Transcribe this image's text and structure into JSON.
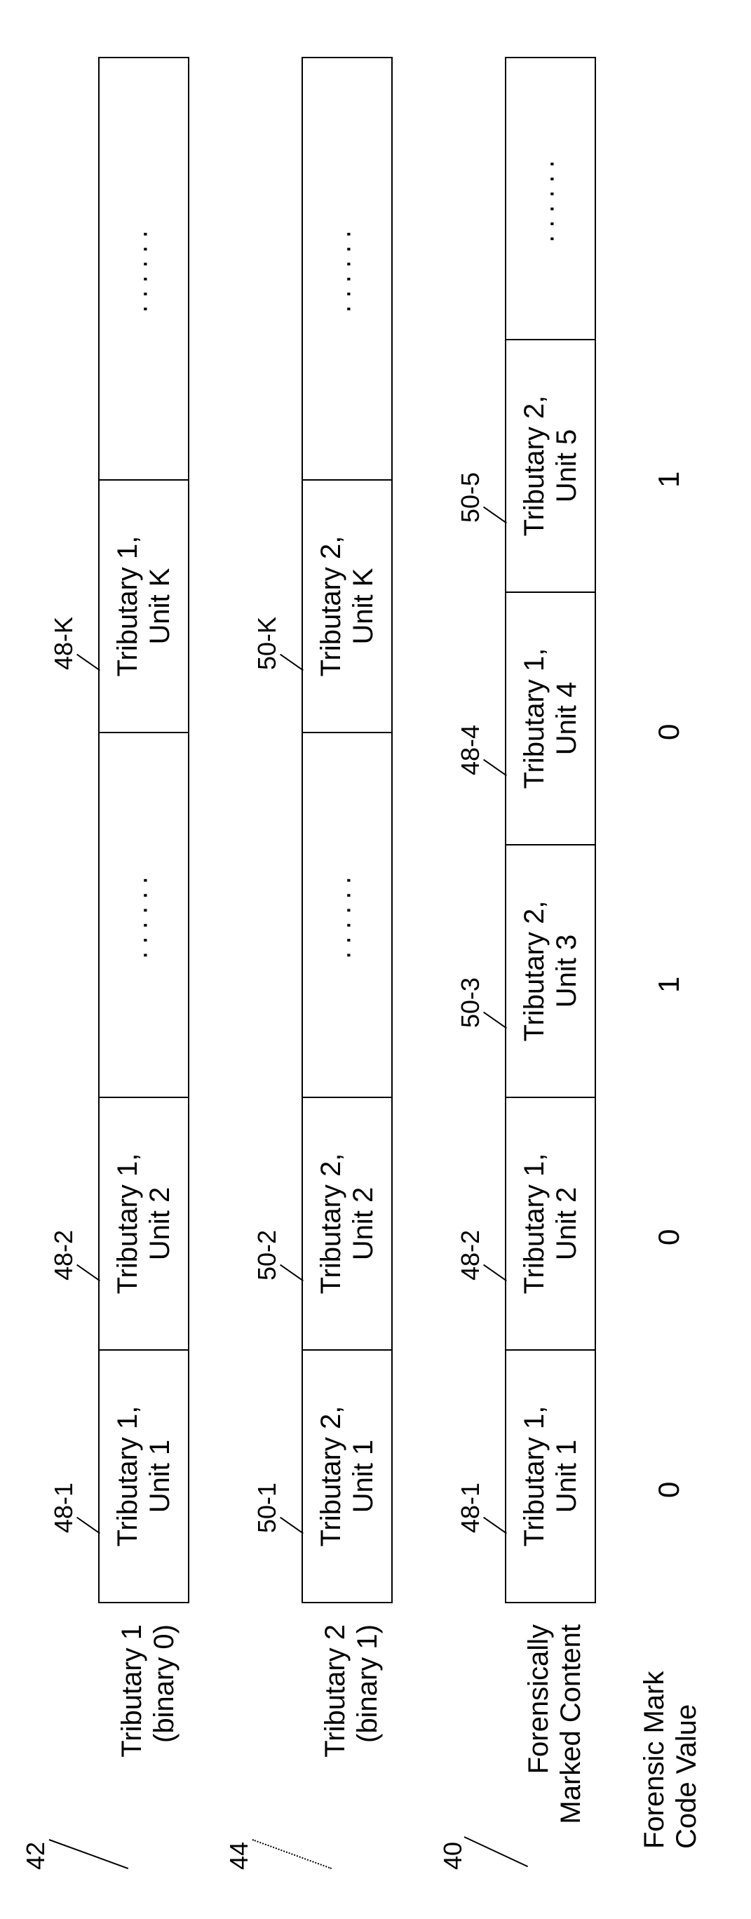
{
  "chart_data": {
    "type": "table",
    "note": "Three horizontal strips showing tributary streams and a forensically marked output selecting units from Tributary 1 (binary 0) or Tributary 2 (binary 1) according to a forensic mark code.",
    "rows": [
      {
        "ref": "42",
        "name": "Tributary 1 (binary 0)",
        "cells": [
          "Tributary 1, Unit 1",
          "Tributary 1, Unit 2",
          "······",
          "Tributary 1, Unit K",
          "······"
        ],
        "cell_refs": [
          "48-1",
          "48-2",
          "",
          "48-K",
          ""
        ]
      },
      {
        "ref": "44",
        "name": "Tributary 2 (binary 1)",
        "cells": [
          "Tributary 2, Unit 1",
          "Tributary 2, Unit 2",
          "······",
          "Tributary 2, Unit K",
          "······"
        ],
        "cell_refs": [
          "50-1",
          "50-2",
          "",
          "50-K",
          ""
        ]
      },
      {
        "ref": "40",
        "name": "Forensically Marked Content",
        "cells": [
          "Tributary 1, Unit 1",
          "Tributary 1, Unit 2",
          "Tributary 2, Unit 3",
          "Tributary 1, Unit 4",
          "Tributary 2, Unit 5",
          "······"
        ],
        "cell_refs": [
          "48-1",
          "48-2",
          "50-3",
          "48-4",
          "50-5",
          ""
        ]
      }
    ],
    "code_label": "Forensic Mark Code Value",
    "code_values": [
      "0",
      "0",
      "1",
      "0",
      "1"
    ]
  },
  "row1": {
    "ref": "42",
    "label_l1": "Tributary 1",
    "label_l2": "(binary 0)",
    "c1": "Tributary 1,\nUnit 1",
    "c2": "Tributary 1,\nUnit 2",
    "cdots": "······",
    "c3": "Tributary 1,\nUnit K",
    "c4dots": "······",
    "r1": "48-1",
    "r2": "48-2",
    "r3": "48-K"
  },
  "row2": {
    "ref": "44",
    "label_l1": "Tributary 2",
    "label_l2": "(binary 1)",
    "c1": "Tributary 2,\nUnit 1",
    "c2": "Tributary 2,\nUnit 2",
    "cdots": "······",
    "c3": "Tributary 2,\nUnit K",
    "c4dots": "······",
    "r1": "50-1",
    "r2": "50-2",
    "r3": "50-K"
  },
  "row3": {
    "ref": "40",
    "label_l1": "Forensically",
    "label_l2": "Marked Content",
    "c1": "Tributary 1,\nUnit 1",
    "c2": "Tributary 1,\nUnit 2",
    "c3": "Tributary 2,\nUnit 3",
    "c4": "Tributary 1,\nUnit 4",
    "c5": "Tributary 2,\nUnit 5",
    "c6dots": "······",
    "r1": "48-1",
    "r2": "48-2",
    "r3": "50-3",
    "r4": "48-4",
    "r5": "50-5"
  },
  "codes": {
    "label_l1": "Forensic Mark",
    "label_l2": "Code Value",
    "v1": "0",
    "v2": "0",
    "v3": "1",
    "v4": "0",
    "v5": "1"
  }
}
